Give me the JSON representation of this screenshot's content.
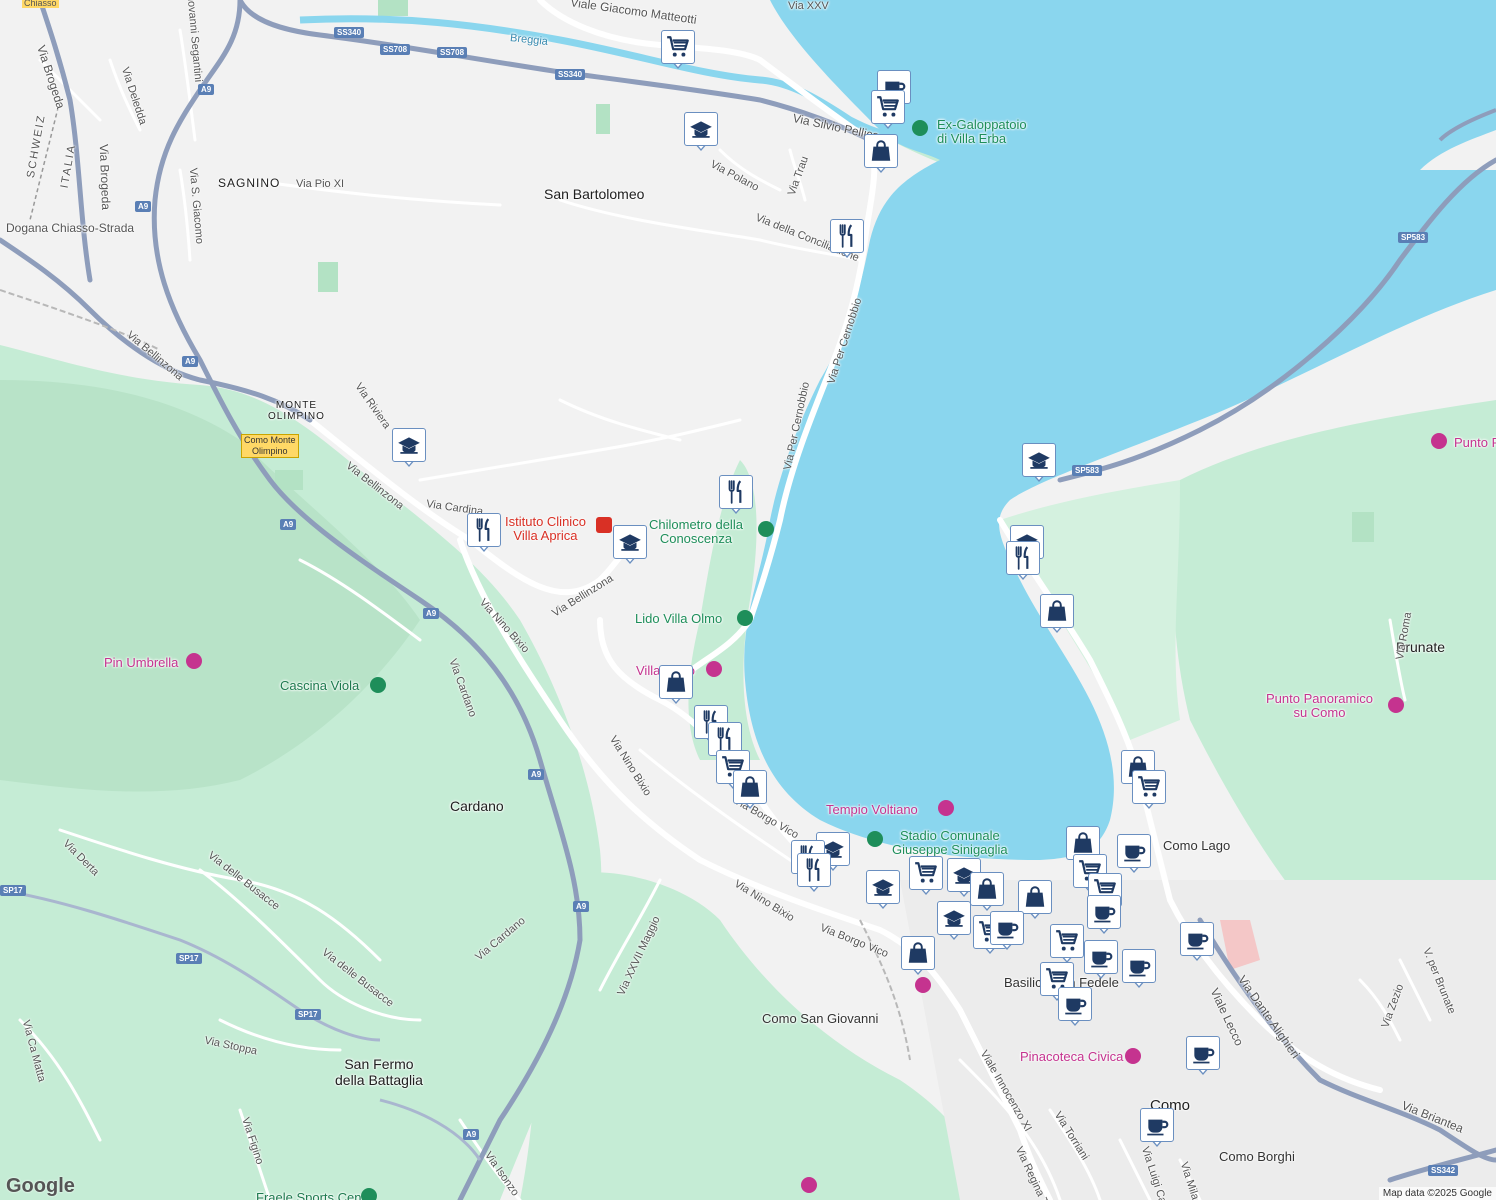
{
  "map": {
    "attribution": "Map data ©2025 Google",
    "logo": "Google",
    "colors": {
      "water": "#8ad6ee",
      "land": "#f2f2f2",
      "park": "#c5ecd5",
      "road": "#ffffff",
      "highway": "#8e9dbb",
      "marker_icon": "#1f3a63"
    }
  },
  "labels": {
    "places": [
      "San Bartolomeo",
      "SAGNINO",
      "Cardano",
      "San Fermo\ndella Battaglia",
      "Brunate",
      "Como",
      "MONTE\nOLIMPINO"
    ],
    "pois_green": [
      "Ex-Galoppatoio\ndi Villa Erba",
      "Chilometro della\nConoscenza",
      "Lido Villa Olmo",
      "Cascina Viola",
      "Stadio Comunale\nGiuseppe Sinigaglia",
      "Fraele Sports Center"
    ],
    "pois_pink": [
      "Pin Umbrella",
      "Tempio Voltiano",
      "Punto Panoramico\nsu Como",
      "Pinacoteca Civica",
      "Punto P",
      "Villa Olmo"
    ],
    "pois_red": [
      "Istituto Clinico\nVilla Aprica"
    ],
    "pois_dark": [
      "Como Lago",
      "Como San Giovanni",
      "Como Borghi",
      "Basilica San Fedele"
    ],
    "streets": [
      "Viale Giacomo Matteotti",
      "Breggia",
      "Via XXV",
      "Via Silvio Pellico",
      "Via Polano",
      "Via Trau",
      "Via della Conciliazione",
      "Via Per Cernobbio",
      "Via Per Cernobbio",
      "Via Bellinzona",
      "Via Bellinzona",
      "Via Bellinzona",
      "Via Cardina",
      "Via Riviera",
      "Via Nino Bixio",
      "Via Nino Bixio",
      "Via Nino Bixio",
      "Via Cardano",
      "Via Cardano",
      "Via delle Busacce",
      "Via delle Busacce",
      "Via Derta",
      "Via Stoppa",
      "Via Ca Matta",
      "Via Figino",
      "Via Isonzo",
      "Via XXVII Maggio",
      "Via Borgo Vico",
      "Via Borgo Vico",
      "Viale Innocenzo XI",
      "Via Torriani",
      "Via Regina T",
      "Via Luigi Cado",
      "Via Mila",
      "Via Dante Alighieri",
      "Viale Lecco",
      "Via Briantea",
      "Via Zezio",
      "V. per Brunate",
      "Via Roma",
      "Via Brogeda",
      "Via Brogeda",
      "Via Deledda",
      "Via S. Giacomo",
      "Via Pio XI",
      "Dogana Chiasso-Strada",
      "Giovanni Segantini",
      "SCHWEIZ",
      "ITALIA",
      "Chiasso"
    ],
    "shields": [
      "SS340",
      "SS708",
      "SS708",
      "SS340",
      "A9",
      "A9",
      "A9",
      "A9",
      "A9",
      "A9",
      "A9",
      "SP583",
      "SP17",
      "SP17",
      "SP17",
      "SP583",
      "SS342",
      "A9"
    ],
    "stations": [
      "Como Monte\nOlimpino"
    ]
  },
  "markers": [
    {
      "type": "shopping-cart-icon"
    },
    {
      "type": "cafe-icon"
    },
    {
      "type": "shopping-cart-icon"
    },
    {
      "type": "school-icon"
    },
    {
      "type": "shopping-bag-icon"
    },
    {
      "type": "restaurant-icon"
    },
    {
      "type": "school-icon"
    },
    {
      "type": "restaurant-icon"
    },
    {
      "type": "restaurant-icon"
    },
    {
      "type": "school-icon"
    },
    {
      "type": "shopping-bag-icon"
    },
    {
      "type": "restaurant-icon"
    },
    {
      "type": "restaurant-icon"
    },
    {
      "type": "shopping-cart-icon"
    },
    {
      "type": "shopping-bag-icon"
    },
    {
      "type": "school-icon"
    },
    {
      "type": "school-icon"
    },
    {
      "type": "restaurant-icon"
    },
    {
      "type": "shopping-bag-icon"
    },
    {
      "type": "school-icon"
    },
    {
      "type": "restaurant-icon"
    },
    {
      "type": "restaurant-icon"
    },
    {
      "type": "school-icon"
    },
    {
      "type": "shopping-cart-icon"
    },
    {
      "type": "school-icon"
    },
    {
      "type": "shopping-bag-icon"
    },
    {
      "type": "shopping-bag-icon"
    },
    {
      "type": "school-icon"
    },
    {
      "type": "shopping-cart-icon"
    },
    {
      "type": "cafe-icon"
    },
    {
      "type": "shopping-bag-icon"
    },
    {
      "type": "shopping-bag-icon"
    },
    {
      "type": "shopping-cart-icon"
    },
    {
      "type": "shopping-cart-icon"
    },
    {
      "type": "cafe-icon"
    },
    {
      "type": "cafe-icon"
    },
    {
      "type": "shopping-cart-icon"
    },
    {
      "type": "cafe-icon"
    },
    {
      "type": "cafe-icon"
    },
    {
      "type": "shopping-cart-icon"
    },
    {
      "type": "cafe-icon"
    },
    {
      "type": "shopping-bag-icon"
    },
    {
      "type": "shopping-cart-icon"
    },
    {
      "type": "cafe-icon"
    },
    {
      "type": "cafe-icon"
    },
    {
      "type": "cafe-icon"
    }
  ]
}
